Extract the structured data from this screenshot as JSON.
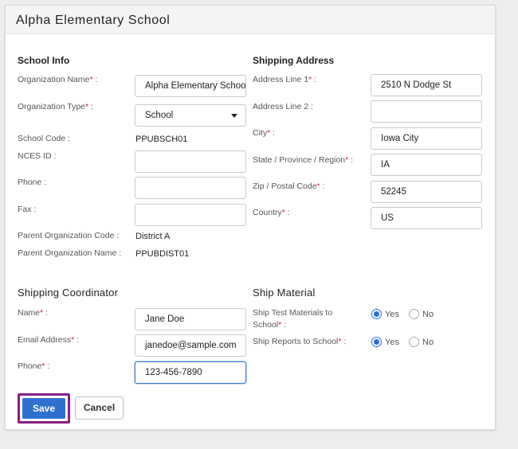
{
  "page": {
    "title": "Alpha Elementary School"
  },
  "school_info": {
    "section_title": "School Info",
    "org_name": {
      "label": "Organization Name",
      "value": "Alpha Elementary School"
    },
    "org_type": {
      "label": "Organization Type",
      "value": "School"
    },
    "school_code": {
      "label": "School Code :",
      "value": "PPUBSCH01"
    },
    "nces_id": {
      "label": "NCES ID :",
      "value": ""
    },
    "phone": {
      "label": "Phone :",
      "value": ""
    },
    "fax": {
      "label": "Fax :",
      "value": ""
    },
    "parent_org_code": {
      "label": "Parent Organization Code :",
      "value": "District A"
    },
    "parent_org_name": {
      "label": "Parent Organization Name :",
      "value": "PPUBDIST01"
    }
  },
  "shipping_address": {
    "section_title": "Shipping Address",
    "line1": {
      "label": "Address Line 1",
      "value": "2510 N Dodge St"
    },
    "line2": {
      "label": "Address Line 2 :",
      "value": ""
    },
    "city": {
      "label": "City",
      "value": "Iowa City"
    },
    "state": {
      "label": "State / Province / Region",
      "value": "IA"
    },
    "zip": {
      "label": "Zip / Postal Code",
      "value": "52245"
    },
    "country": {
      "label": "Country",
      "value": "US"
    }
  },
  "coordinator": {
    "section_title": "Shipping Coordinator",
    "name": {
      "label": "Name",
      "value": "Jane Doe"
    },
    "email": {
      "label": "Email Address",
      "value": "janedoe@sample.com"
    },
    "phone": {
      "label": "Phone",
      "value": "123-456-7890"
    }
  },
  "ship_material": {
    "section_title": "Ship Material",
    "test_materials": {
      "label_line1": "Ship Test Materials to",
      "label_line2": "School",
      "selected": "Yes"
    },
    "reports": {
      "label": "Ship Reports to School",
      "selected": "Yes"
    },
    "yes_label": "Yes",
    "no_label": "No"
  },
  "actions": {
    "save": "Save",
    "cancel": "Cancel"
  },
  "symbols": {
    "required": "*",
    "colon": " :"
  },
  "colors": {
    "primary": "#2f6fd0",
    "required": "#d9222a",
    "highlight": "#8a1e83"
  }
}
